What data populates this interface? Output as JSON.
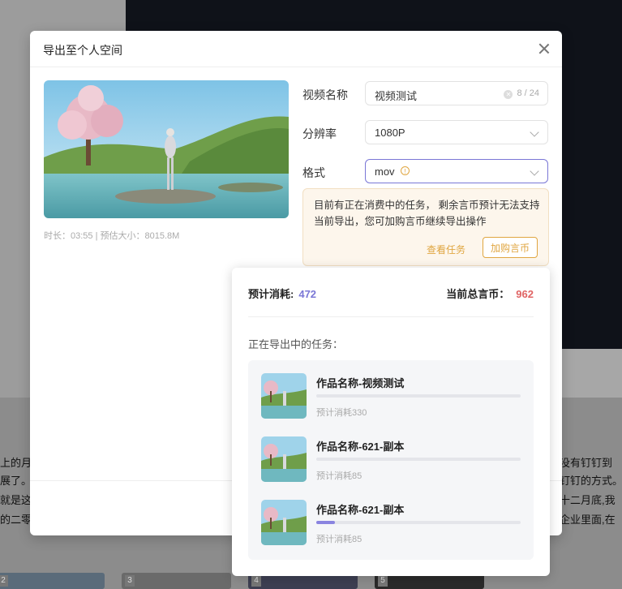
{
  "modal": {
    "title": "导出至个人空间",
    "meta": "时长：03:55 | 预估大小：8015.8M",
    "name_label": "视频名称",
    "name_value": "视频测试",
    "name_count": "8 / 24",
    "resolution_label": "分辨率",
    "resolution_value": "1080P",
    "format_label": "格式",
    "format_value": "mov",
    "warning_text": "目前有正在消费中的任务， 剩余言币预计无法支持当前导出，您可加购言币继续导出操作",
    "view_tasks_label": "查看任务",
    "buy_coins_label": "加购言币"
  },
  "popover": {
    "cost_label": "预计消耗:",
    "cost_value": "472",
    "total_label": "当前总言币：",
    "total_value": "962",
    "tasks_heading": "正在导出中的任务：",
    "tasks": [
      {
        "name": "作品名称-视频测试",
        "cost": "预计消耗330",
        "progress": 0
      },
      {
        "name": "作品名称-621-副本",
        "cost": "预计消耗85",
        "progress": 0
      },
      {
        "name": "作品名称-621-副本",
        "cost": "预计消耗85",
        "progress": 0.09
      }
    ]
  },
  "background": {
    "lines_left": [
      "上的月",
      "展了。",
      "就是这",
      "的二零"
    ],
    "lines_right": [
      "没有钉钉到",
      "钉钉的方式。",
      "十二月底,我",
      "企业里面,在"
    ],
    "thumb_numbers": [
      "2",
      "3",
      "4",
      "5"
    ]
  },
  "colors": {
    "accent": "#7a77d6",
    "warning": "#e0a641",
    "danger": "#e06464"
  }
}
